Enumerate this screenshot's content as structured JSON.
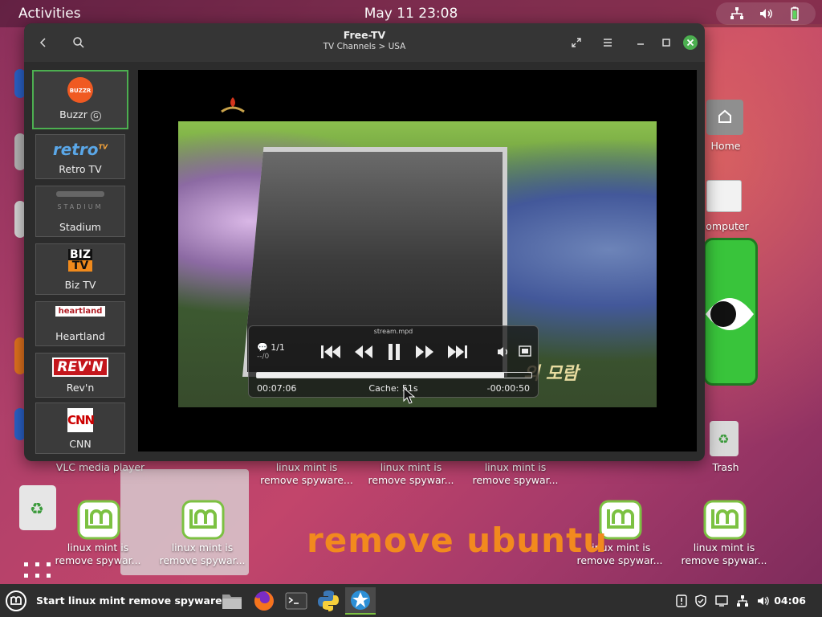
{
  "topbar": {
    "activities": "Activities",
    "clock": "May 11  23:08"
  },
  "window": {
    "title": "Free-TV",
    "subtitle": "TV Channels > USA",
    "channels": [
      {
        "name": "Buzzr",
        "logo_text": "BUZZR"
      },
      {
        "name": "Retro TV",
        "logo_text": "retro",
        "logo_sup": "TV"
      },
      {
        "name": "Stadium",
        "logo_text": "STADIUM"
      },
      {
        "name": "Biz TV",
        "logo_text": "BIZ",
        "logo_text2": "TV"
      },
      {
        "name": "Heartland",
        "logo_text": "heartland"
      },
      {
        "name": "Rev'n",
        "logo_text": "REV'N"
      },
      {
        "name": "CNN",
        "logo_text": "CNN"
      }
    ],
    "buzzr_badge": "G"
  },
  "player": {
    "stream_name": "stream.mpd",
    "playlist_count": "1/1",
    "chapter_info": "--/0",
    "time_elapsed": "00:07:06",
    "cache": "Cache:  51s",
    "time_remaining": "-00:00:50",
    "progress": 0.9,
    "caption": "의 모람"
  },
  "desktop": {
    "vlc_label": "VLC media player",
    "home_label": "Home",
    "computer_label": "omputer",
    "trash_label": "Trash",
    "mint_line1": "linux mint is",
    "mint_line2_a": "remove spyware...",
    "mint_line2_b": "remove spywar...",
    "mint_line2_c": "remove spywar...",
    "big_text": "remove ubuntu",
    "home_partial": "Home"
  },
  "taskbar": {
    "start_label": "Start linux mint remove spyware",
    "time": "04:06"
  },
  "colors": {
    "accent_green": "#4caf50",
    "mint_green": "#7cc142",
    "orange_text": "#f28a1e"
  }
}
